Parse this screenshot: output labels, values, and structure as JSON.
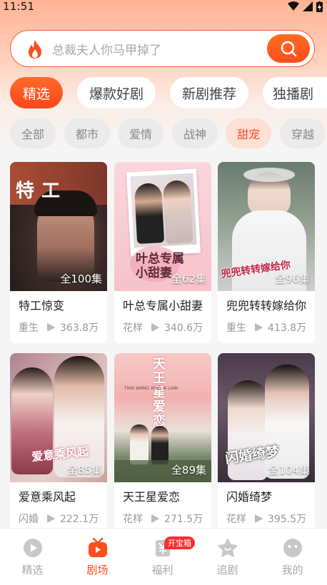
{
  "status_bar": {
    "time": "11:51"
  },
  "search": {
    "placeholder": "总裁夫人你马甲掉了"
  },
  "primary_tabs": [
    "精选",
    "爆款好剧",
    "新剧推荐",
    "独播剧"
  ],
  "categories": [
    "全部",
    "都市",
    "爱情",
    "战神",
    "甜宠",
    "穿越"
  ],
  "selected_category": "甜宠",
  "cards": [
    {
      "title": "特工惊变",
      "episodes": "全100集",
      "genre": "重生",
      "views": "363.8万",
      "poster_text": "特工"
    },
    {
      "title": "叶总专属小甜妻",
      "episodes": "全62集",
      "genre": "花样",
      "views": "340.6万",
      "poster_text": "叶总专属小甜妻"
    },
    {
      "title": "兜兜转转嫁给你",
      "episodes": "全96集",
      "genre": "重生",
      "views": "413.8万",
      "poster_text": "兜兜转转嫁给你"
    },
    {
      "title": "爱意乘风起",
      "episodes": "全85集",
      "genre": "闪婚",
      "views": "222.1万",
      "poster_text": "爱意乘风起"
    },
    {
      "title": "天王星爱恋",
      "episodes": "全89集",
      "genre": "花样",
      "views": "271.5万",
      "poster_text": "天王星爱恋",
      "poster_pinyin": "TIAN WANG XING AI LIAN"
    },
    {
      "title": "闪婚绮梦",
      "episodes": "全104集",
      "genre": "花样",
      "views": "395.5万",
      "poster_text": "闪婚绮梦"
    }
  ],
  "bottom_nav": [
    {
      "label": "精选",
      "icon": "play-circle-icon"
    },
    {
      "label": "剧场",
      "icon": "tv-icon"
    },
    {
      "label": "福利",
      "icon": "wallet-icon",
      "badge": "开宝箱"
    },
    {
      "label": "追剧",
      "icon": "star-icon"
    },
    {
      "label": "我的",
      "icon": "face-icon"
    }
  ],
  "active_nav": "剧场",
  "colors": {
    "accent": "#ff4d1c",
    "inactive": "#aaaaaa",
    "badge": "#f53131"
  }
}
